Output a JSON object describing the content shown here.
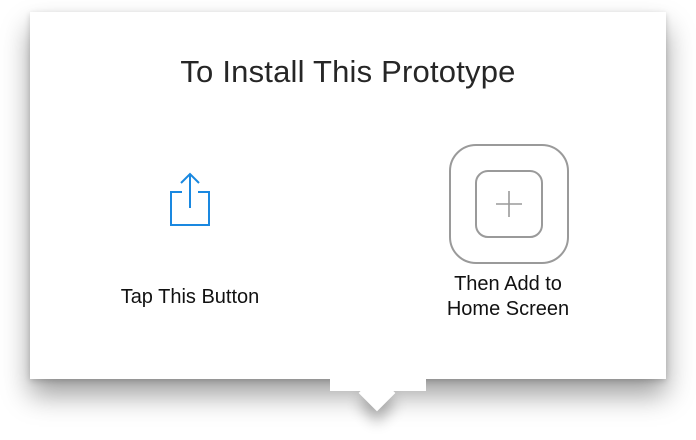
{
  "popover": {
    "title": "To Install This Prototype",
    "step1": {
      "icon": "share-icon",
      "label": "Tap This Button"
    },
    "step2": {
      "icon": "add-to-home-screen-icon",
      "label_line1": "Then Add to",
      "label_line2": "Home Screen"
    }
  },
  "colors": {
    "share_icon": "#1a88e0",
    "home_icon": "#9a9a9a",
    "title_text": "#262626",
    "label_text": "#111111"
  }
}
